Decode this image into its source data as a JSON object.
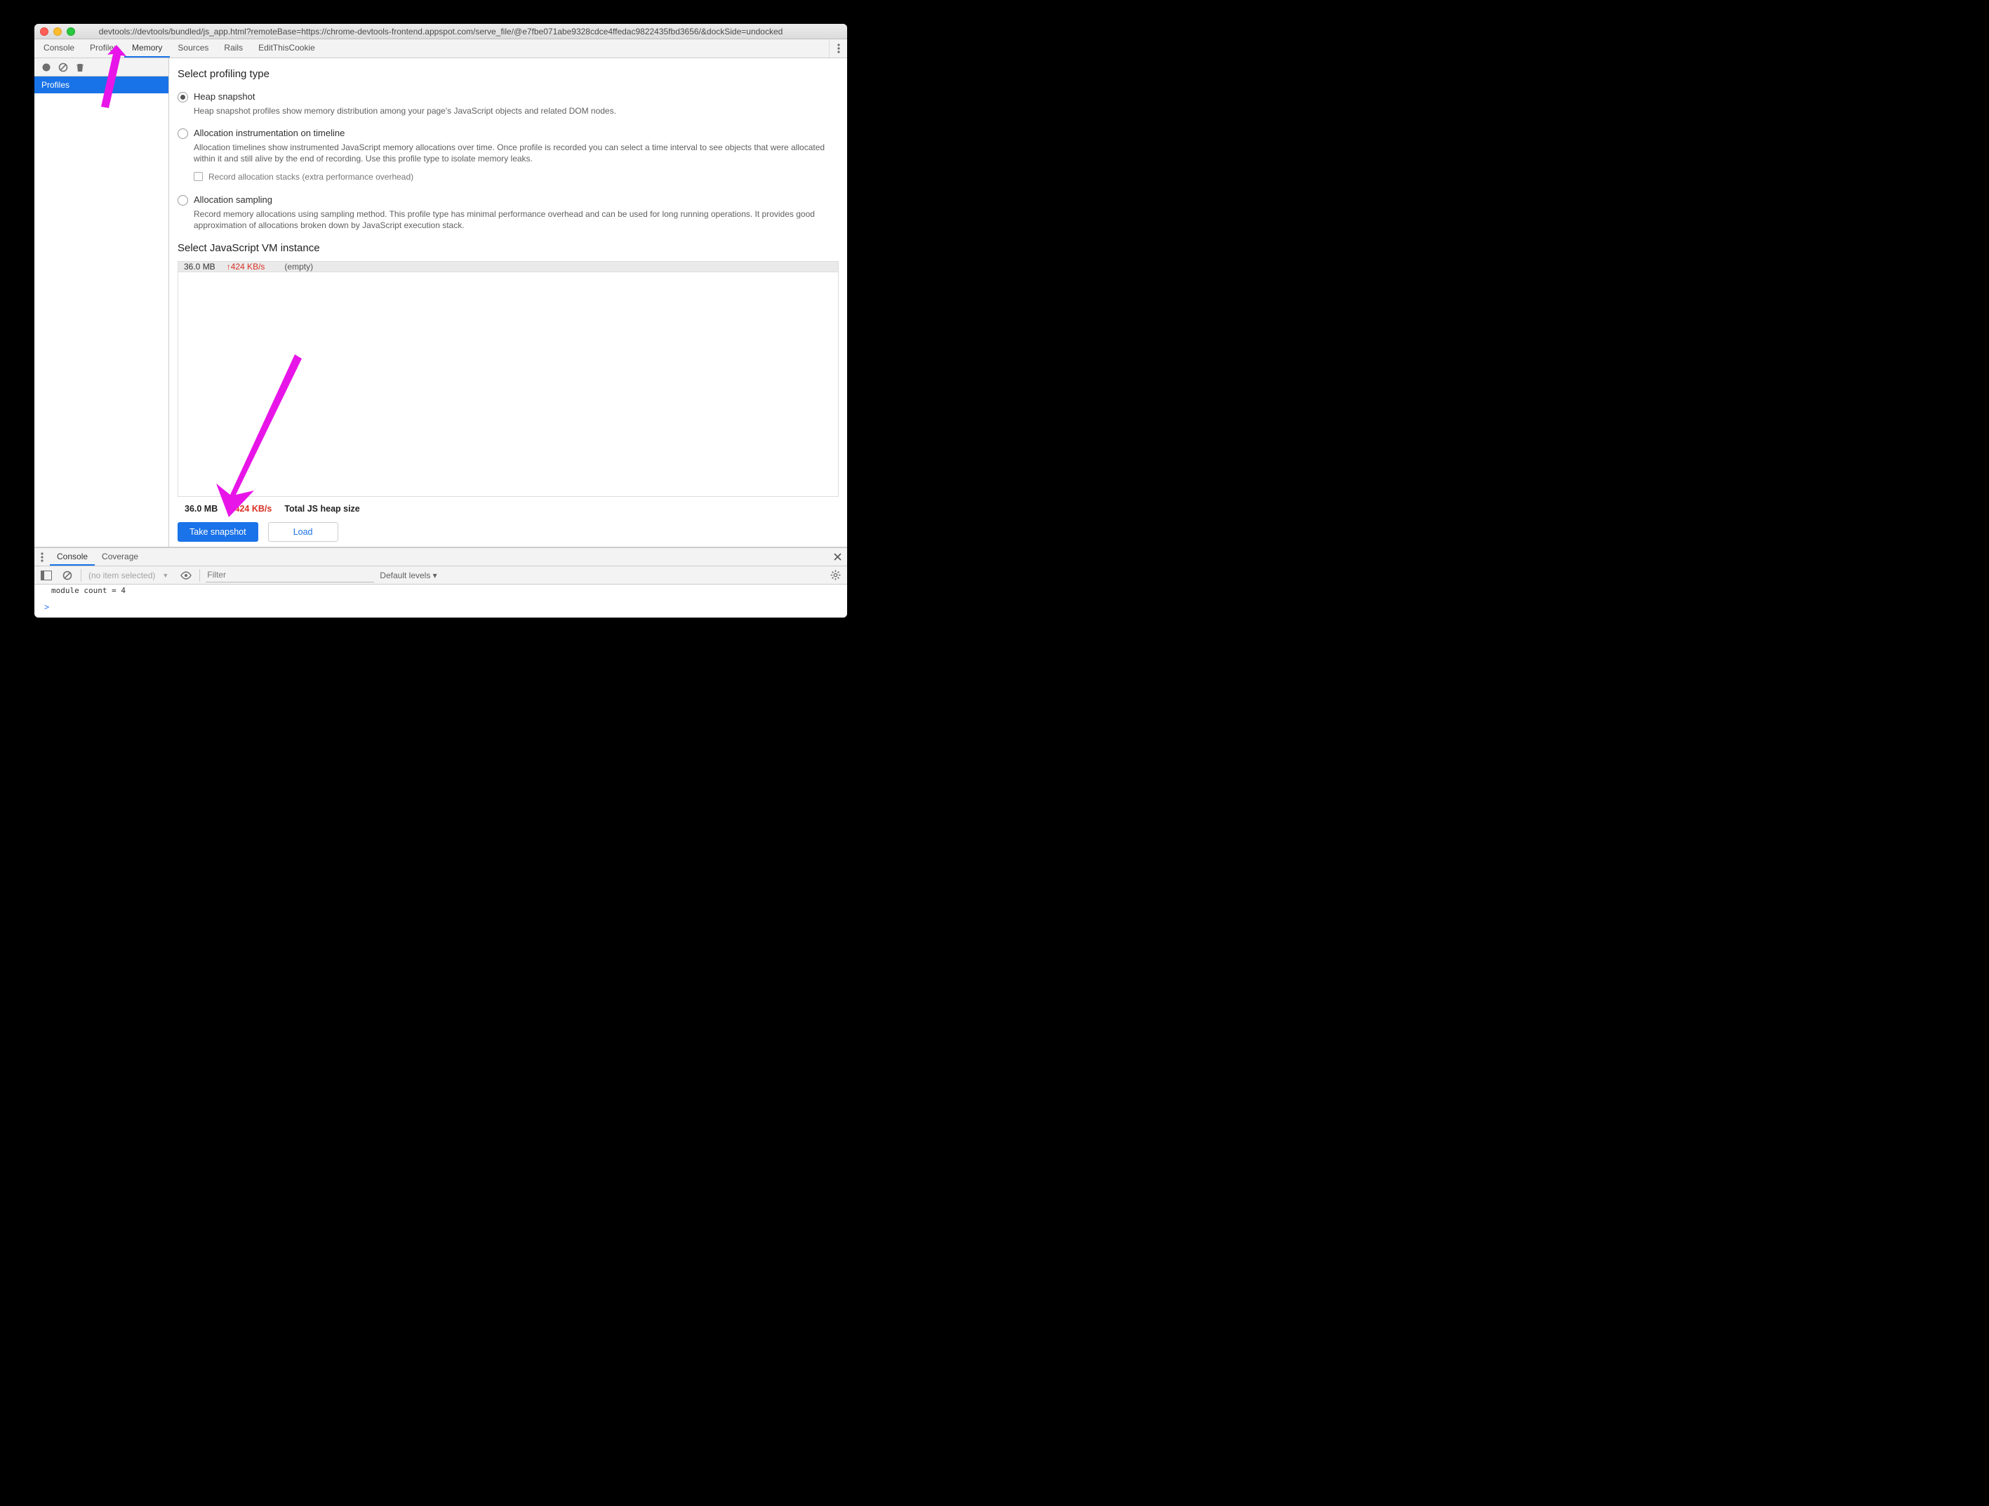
{
  "window": {
    "title": "devtools://devtools/bundled/js_app.html?remoteBase=https://chrome-devtools-frontend.appspot.com/serve_file/@e7fbe071abe9328cdce4ffedac9822435fbd3656/&dockSide=undocked"
  },
  "tabs": {
    "items": [
      "Console",
      "Profiler",
      "Memory",
      "Sources",
      "Rails",
      "EditThisCookie"
    ],
    "active_index": 2
  },
  "sidebar": {
    "items": [
      "Profiles"
    ],
    "active_index": 0
  },
  "profiling": {
    "section_title": "Select profiling type",
    "options": [
      {
        "title": "Heap snapshot",
        "desc": "Heap snapshot profiles show memory distribution among your page's JavaScript objects and related DOM nodes.",
        "checked": true
      },
      {
        "title": "Allocation instrumentation on timeline",
        "desc": "Allocation timelines show instrumented JavaScript memory allocations over time. Once profile is recorded you can select a time interval to see objects that were allocated within it and still alive by the end of recording. Use this profile type to isolate memory leaks.",
        "checked": false,
        "sub_checkbox": "Record allocation stacks (extra performance overhead)"
      },
      {
        "title": "Allocation sampling",
        "desc": "Record memory allocations using sampling method. This profile type has minimal performance overhead and can be used for long running operations. It provides good approximation of allocations broken down by JavaScript execution stack.",
        "checked": false
      }
    ]
  },
  "vm": {
    "section_title": "Select JavaScript VM instance",
    "row": {
      "mem": "36.0 MB",
      "rate": "424 KB/s",
      "instance": "(empty)"
    }
  },
  "footer": {
    "mem": "36.0 MB",
    "rate": "424 KB/s",
    "rate_prefix_hidden": "",
    "label": "Total JS heap size",
    "primary_btn": "Take snapshot",
    "secondary_btn": "Load"
  },
  "drawer": {
    "tabs": [
      "Console",
      "Coverage"
    ],
    "active_index": 0,
    "context": "(no item selected)",
    "filter_placeholder": "Filter",
    "levels": "Default levels ▾",
    "output": "module count = 4",
    "prompt": ">"
  }
}
